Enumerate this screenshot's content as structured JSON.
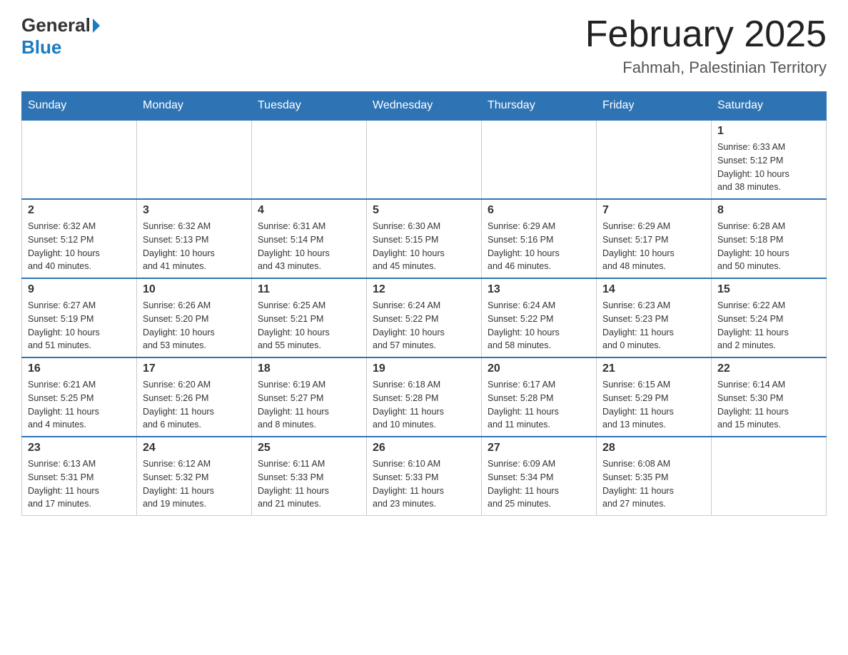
{
  "header": {
    "logo_general": "General",
    "logo_blue": "Blue",
    "month_title": "February 2025",
    "location": "Fahmah, Palestinian Territory"
  },
  "weekdays": [
    "Sunday",
    "Monday",
    "Tuesday",
    "Wednesday",
    "Thursday",
    "Friday",
    "Saturday"
  ],
  "weeks": [
    [
      {
        "day": "",
        "info": ""
      },
      {
        "day": "",
        "info": ""
      },
      {
        "day": "",
        "info": ""
      },
      {
        "day": "",
        "info": ""
      },
      {
        "day": "",
        "info": ""
      },
      {
        "day": "",
        "info": ""
      },
      {
        "day": "1",
        "info": "Sunrise: 6:33 AM\nSunset: 5:12 PM\nDaylight: 10 hours\nand 38 minutes."
      }
    ],
    [
      {
        "day": "2",
        "info": "Sunrise: 6:32 AM\nSunset: 5:12 PM\nDaylight: 10 hours\nand 40 minutes."
      },
      {
        "day": "3",
        "info": "Sunrise: 6:32 AM\nSunset: 5:13 PM\nDaylight: 10 hours\nand 41 minutes."
      },
      {
        "day": "4",
        "info": "Sunrise: 6:31 AM\nSunset: 5:14 PM\nDaylight: 10 hours\nand 43 minutes."
      },
      {
        "day": "5",
        "info": "Sunrise: 6:30 AM\nSunset: 5:15 PM\nDaylight: 10 hours\nand 45 minutes."
      },
      {
        "day": "6",
        "info": "Sunrise: 6:29 AM\nSunset: 5:16 PM\nDaylight: 10 hours\nand 46 minutes."
      },
      {
        "day": "7",
        "info": "Sunrise: 6:29 AM\nSunset: 5:17 PM\nDaylight: 10 hours\nand 48 minutes."
      },
      {
        "day": "8",
        "info": "Sunrise: 6:28 AM\nSunset: 5:18 PM\nDaylight: 10 hours\nand 50 minutes."
      }
    ],
    [
      {
        "day": "9",
        "info": "Sunrise: 6:27 AM\nSunset: 5:19 PM\nDaylight: 10 hours\nand 51 minutes."
      },
      {
        "day": "10",
        "info": "Sunrise: 6:26 AM\nSunset: 5:20 PM\nDaylight: 10 hours\nand 53 minutes."
      },
      {
        "day": "11",
        "info": "Sunrise: 6:25 AM\nSunset: 5:21 PM\nDaylight: 10 hours\nand 55 minutes."
      },
      {
        "day": "12",
        "info": "Sunrise: 6:24 AM\nSunset: 5:22 PM\nDaylight: 10 hours\nand 57 minutes."
      },
      {
        "day": "13",
        "info": "Sunrise: 6:24 AM\nSunset: 5:22 PM\nDaylight: 10 hours\nand 58 minutes."
      },
      {
        "day": "14",
        "info": "Sunrise: 6:23 AM\nSunset: 5:23 PM\nDaylight: 11 hours\nand 0 minutes."
      },
      {
        "day": "15",
        "info": "Sunrise: 6:22 AM\nSunset: 5:24 PM\nDaylight: 11 hours\nand 2 minutes."
      }
    ],
    [
      {
        "day": "16",
        "info": "Sunrise: 6:21 AM\nSunset: 5:25 PM\nDaylight: 11 hours\nand 4 minutes."
      },
      {
        "day": "17",
        "info": "Sunrise: 6:20 AM\nSunset: 5:26 PM\nDaylight: 11 hours\nand 6 minutes."
      },
      {
        "day": "18",
        "info": "Sunrise: 6:19 AM\nSunset: 5:27 PM\nDaylight: 11 hours\nand 8 minutes."
      },
      {
        "day": "19",
        "info": "Sunrise: 6:18 AM\nSunset: 5:28 PM\nDaylight: 11 hours\nand 10 minutes."
      },
      {
        "day": "20",
        "info": "Sunrise: 6:17 AM\nSunset: 5:28 PM\nDaylight: 11 hours\nand 11 minutes."
      },
      {
        "day": "21",
        "info": "Sunrise: 6:15 AM\nSunset: 5:29 PM\nDaylight: 11 hours\nand 13 minutes."
      },
      {
        "day": "22",
        "info": "Sunrise: 6:14 AM\nSunset: 5:30 PM\nDaylight: 11 hours\nand 15 minutes."
      }
    ],
    [
      {
        "day": "23",
        "info": "Sunrise: 6:13 AM\nSunset: 5:31 PM\nDaylight: 11 hours\nand 17 minutes."
      },
      {
        "day": "24",
        "info": "Sunrise: 6:12 AM\nSunset: 5:32 PM\nDaylight: 11 hours\nand 19 minutes."
      },
      {
        "day": "25",
        "info": "Sunrise: 6:11 AM\nSunset: 5:33 PM\nDaylight: 11 hours\nand 21 minutes."
      },
      {
        "day": "26",
        "info": "Sunrise: 6:10 AM\nSunset: 5:33 PM\nDaylight: 11 hours\nand 23 minutes."
      },
      {
        "day": "27",
        "info": "Sunrise: 6:09 AM\nSunset: 5:34 PM\nDaylight: 11 hours\nand 25 minutes."
      },
      {
        "day": "28",
        "info": "Sunrise: 6:08 AM\nSunset: 5:35 PM\nDaylight: 11 hours\nand 27 minutes."
      },
      {
        "day": "",
        "info": ""
      }
    ]
  ]
}
